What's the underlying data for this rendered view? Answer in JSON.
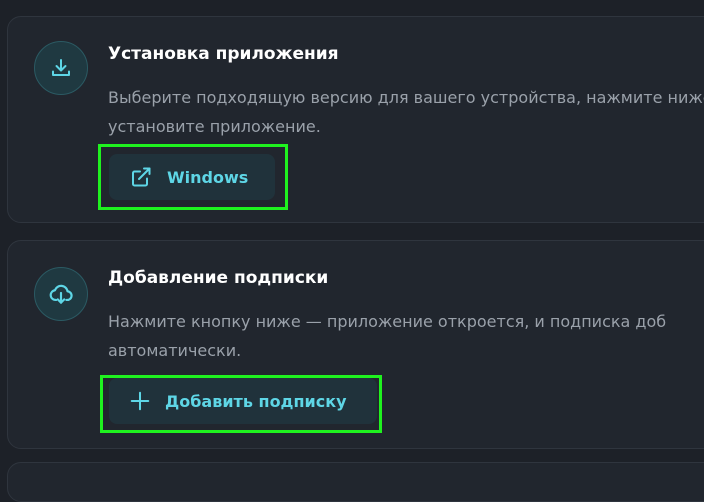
{
  "steps": [
    {
      "icon": "download-icon",
      "title": "Установка приложения",
      "description": "Выберите подходящую версию для вашего устройства, нажмите ниже и установите приложение.",
      "button": {
        "icon": "external-link-icon",
        "label": "Windows"
      }
    },
    {
      "icon": "cloud-download-icon",
      "title": "Добавление подписки",
      "description": "Нажмите кнопку ниже — приложение откроется, и подписка доб автоматически.",
      "button": {
        "icon": "plus-icon",
        "label": "Добавить подписку"
      }
    }
  ],
  "colors": {
    "background": "#1d2128",
    "card": "#21262e",
    "accent": "#5ed6e6",
    "highlight": "#1ff21f"
  }
}
